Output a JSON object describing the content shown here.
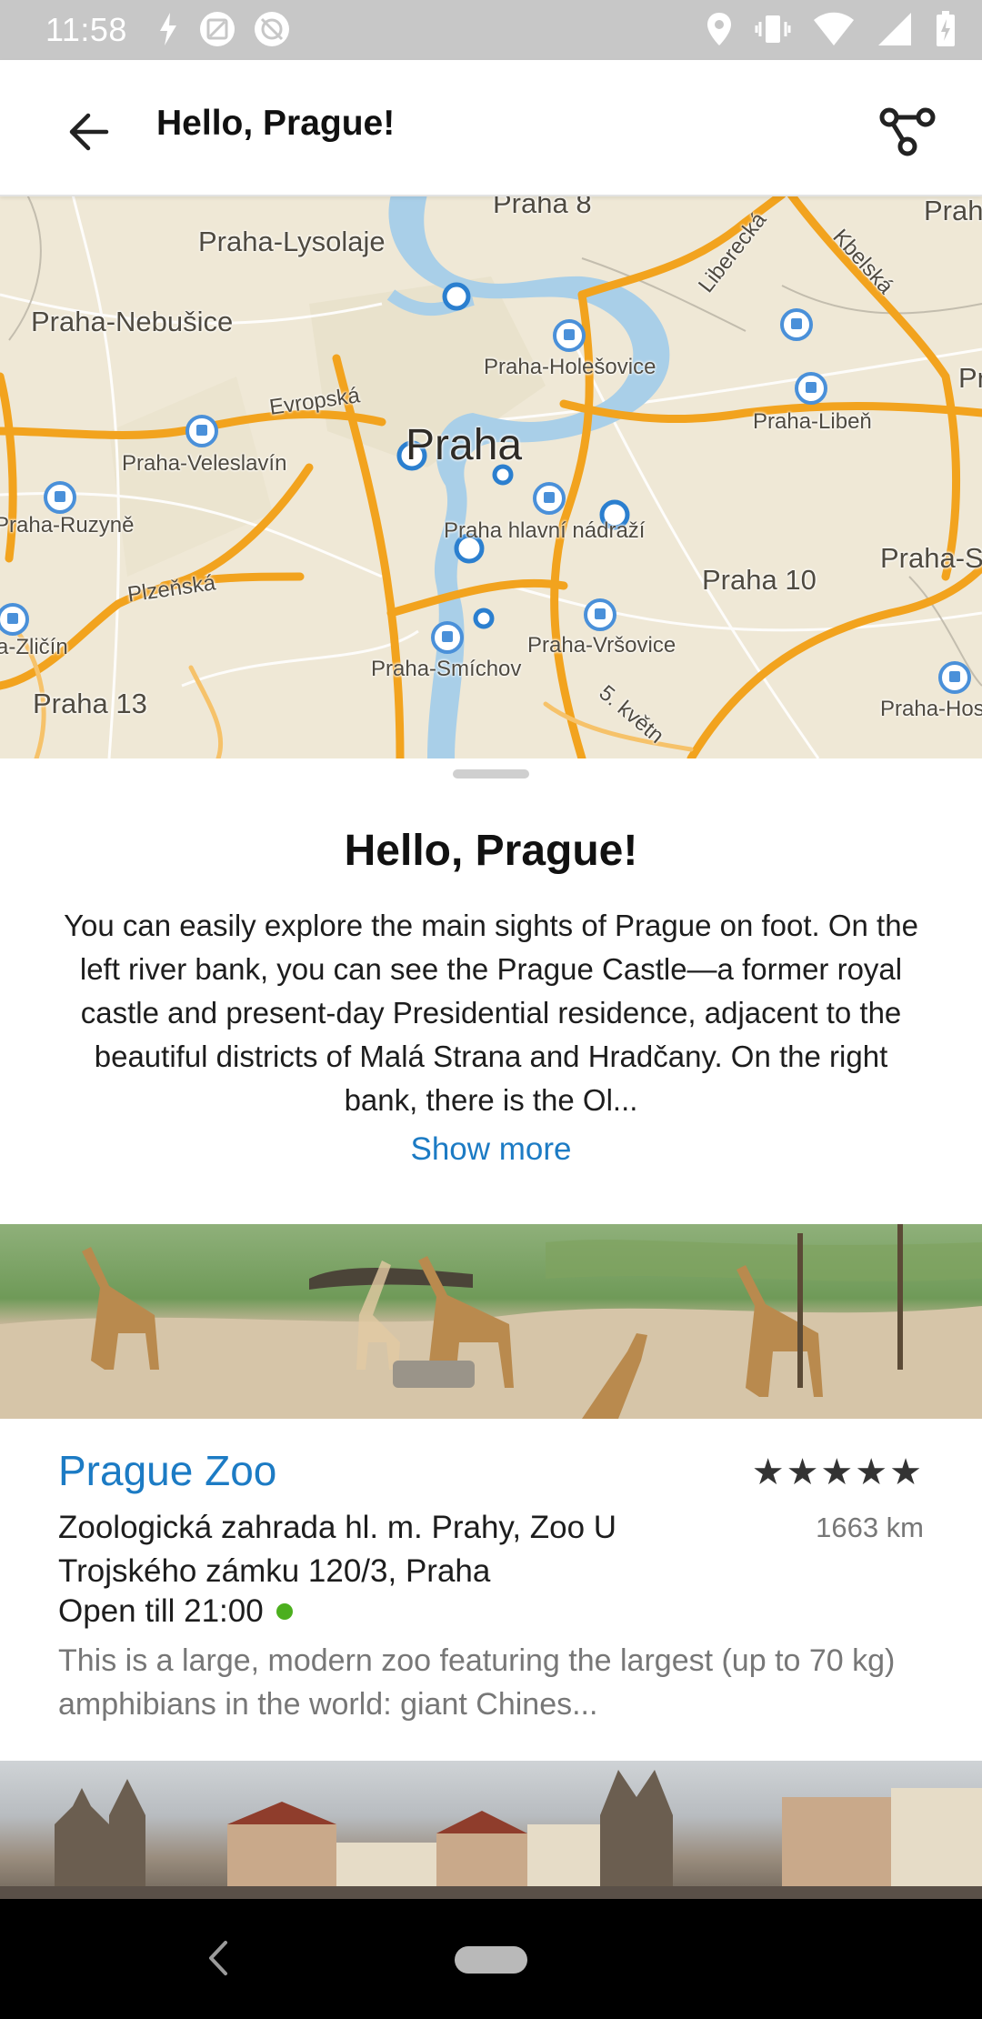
{
  "status_bar": {
    "time": "11:58",
    "left_icons": [
      "flash-icon",
      "screenshot-icon",
      "sync-disabled-icon"
    ],
    "right_icons": [
      "location-icon",
      "vibrate-icon",
      "wifi-icon",
      "signal-icon",
      "battery-charging-icon"
    ]
  },
  "app_bar": {
    "title": "Hello, Prague!",
    "back_icon": "arrow-left-icon",
    "route_icon": "route-icon"
  },
  "map": {
    "labels": {
      "praha8": "Praha 8",
      "lysolaje": "Praha-Lysolaje",
      "nebusice": "Praha-Nebušice",
      "holesovice": "Praha-Holešovice",
      "liberecka": "Liberecká",
      "kbelska": "Kbelská",
      "prah_right": "Prah",
      "pr_right": "Pr",
      "liben": "Praha-Libeň",
      "evropska": "Evropská",
      "veleslavin": "Praha-Veleslavín",
      "praha": "Praha",
      "ruzyne": "Praha-Ruzyně",
      "hlavni": "Praha hlavní nádraží",
      "praha10": "Praha 10",
      "praha_s": "Praha-S",
      "plzenska": "Plzeňská",
      "zlicin": "a-Zličín",
      "vrsovice": "Praha-Vršovice",
      "smichov": "Praha-Smíchov",
      "hos": "Praha-Hos",
      "praha13": "Praha 13",
      "kvetna": "5. květn"
    }
  },
  "sheet": {
    "title": "Hello, Prague!",
    "description": "You can easily explore the main sights of Prague on foot. On the left river bank, you can see the Prague Castle—a former royal castle and present-day Presidential residence, adjacent to the beautiful districts of Malá Strana and Hradčany. On the right bank, there is the Ol...",
    "show_more": "Show more"
  },
  "places": [
    {
      "name": "Prague Zoo",
      "rating_stars": "★★★★★",
      "address": "Zoologická zahrada hl. m. Prahy, Zoo U Trojského zámku 120/3, Praha",
      "distance": "1663 km",
      "hours": "Open till 21:00",
      "description": "This is a large, modern zoo featuring the largest (up to 70 kg) amphibians in the world: giant Chines...",
      "status_color": "#4caf1e"
    }
  ],
  "nav_bar": {
    "back_icon": "nav-back-icon",
    "home_icon": "nav-home-pill"
  },
  "colors": {
    "accent": "#1c7bc4",
    "map_background": "#efe8d6",
    "road": "#f2a31e",
    "water": "#a9cfe8"
  }
}
